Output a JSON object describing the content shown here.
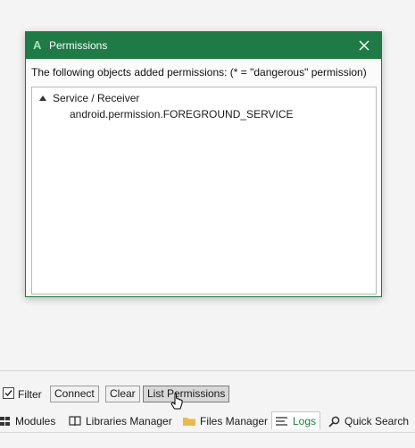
{
  "dialog": {
    "app_icon": "A",
    "title": "Permissions",
    "description": "The following objects added permissions: (* = \"dangerous\" permission)",
    "tree": {
      "node_label": "Service / Receiver",
      "children": [
        "android.permission.FOREGROUND_SERVICE"
      ]
    }
  },
  "toolbar": {
    "filter_label": "Filter",
    "filter_checked": true,
    "connect_label": "Connect",
    "clear_label": "Clear",
    "list_permissions_label": "List Permissions"
  },
  "tabs": [
    {
      "label": "Modules",
      "icon": "grid-icon"
    },
    {
      "label": "Libraries Manager",
      "icon": "book-icon"
    },
    {
      "label": "Files Manager",
      "icon": "folder-icon"
    },
    {
      "label": "Logs",
      "icon": "lines-icon"
    },
    {
      "label": "Quick Search",
      "icon": "search-icon"
    }
  ],
  "colors": {
    "accent": "#1f7a45",
    "active_tab_text": "#1f7a45"
  }
}
